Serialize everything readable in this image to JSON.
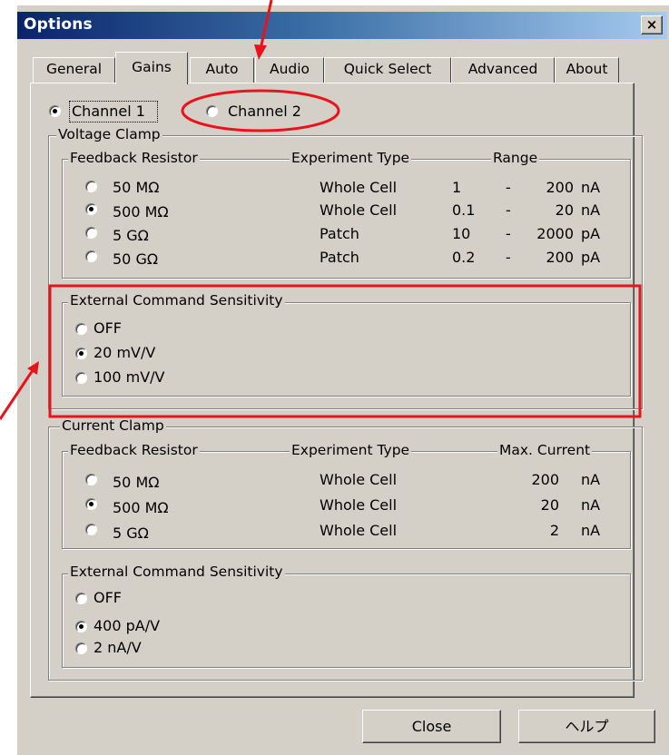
{
  "window": {
    "title": "Options",
    "close_glyph": "×"
  },
  "tabs": [
    {
      "label": "General",
      "active": false
    },
    {
      "label": "Gains",
      "active": true
    },
    {
      "label": "Auto",
      "active": false
    },
    {
      "label": "Audio",
      "active": false
    },
    {
      "label": "Quick Select",
      "active": false
    },
    {
      "label": "Advanced",
      "active": false
    },
    {
      "label": "About",
      "active": false
    }
  ],
  "channels": [
    {
      "label": "Channel 1",
      "selected": true
    },
    {
      "label": "Channel 2",
      "selected": false
    }
  ],
  "voltage_clamp": {
    "title": "Voltage Clamp",
    "feedback_group": {
      "headers": {
        "resistor": "Feedback Resistor",
        "type": "Experiment Type",
        "range": "Range"
      },
      "rows": [
        {
          "resistor": "50 MΩ",
          "type": "Whole Cell",
          "low": "1",
          "dash": "-",
          "high": "200",
          "unit": "nA",
          "selected": false
        },
        {
          "resistor": "500 MΩ",
          "type": "Whole Cell",
          "low": "0.1",
          "dash": "-",
          "high": "20",
          "unit": "nA",
          "selected": true
        },
        {
          "resistor": "5 GΩ",
          "type": "Patch",
          "low": "10",
          "dash": "-",
          "high": "2000",
          "unit": "pA",
          "selected": false
        },
        {
          "resistor": "50 GΩ",
          "type": "Patch",
          "low": "0.2",
          "dash": "-",
          "high": "200",
          "unit": "pA",
          "selected": false
        }
      ]
    },
    "ext_cmd": {
      "title": "External Command Sensitivity",
      "options": [
        {
          "label": "OFF",
          "selected": false
        },
        {
          "label": "20 mV/V",
          "selected": true
        },
        {
          "label": "100 mV/V",
          "selected": false
        }
      ]
    }
  },
  "current_clamp": {
    "title": "Current Clamp",
    "feedback_group": {
      "headers": {
        "resistor": "Feedback Resistor",
        "type": "Experiment Type",
        "max": "Max. Current"
      },
      "rows": [
        {
          "resistor": "50 MΩ",
          "type": "Whole Cell",
          "value": "200",
          "unit": "nA",
          "selected": false
        },
        {
          "resistor": "500 MΩ",
          "type": "Whole Cell",
          "value": "20",
          "unit": "nA",
          "selected": true
        },
        {
          "resistor": "5 GΩ",
          "type": "Whole Cell",
          "value": "2",
          "unit": "nA",
          "selected": false
        }
      ]
    },
    "ext_cmd": {
      "title": "External Command Sensitivity",
      "options": [
        {
          "label": "OFF",
          "selected": false
        },
        {
          "label": "400 pA/V",
          "selected": true
        },
        {
          "label": "2 nA/V",
          "selected": false
        }
      ]
    }
  },
  "buttons": {
    "close": "Close",
    "help": "ヘルプ"
  },
  "annotations": {
    "color": "#e8141c"
  },
  "colors": {
    "dialog_face": "#d4d0c8",
    "title_active": "#0a246a"
  }
}
